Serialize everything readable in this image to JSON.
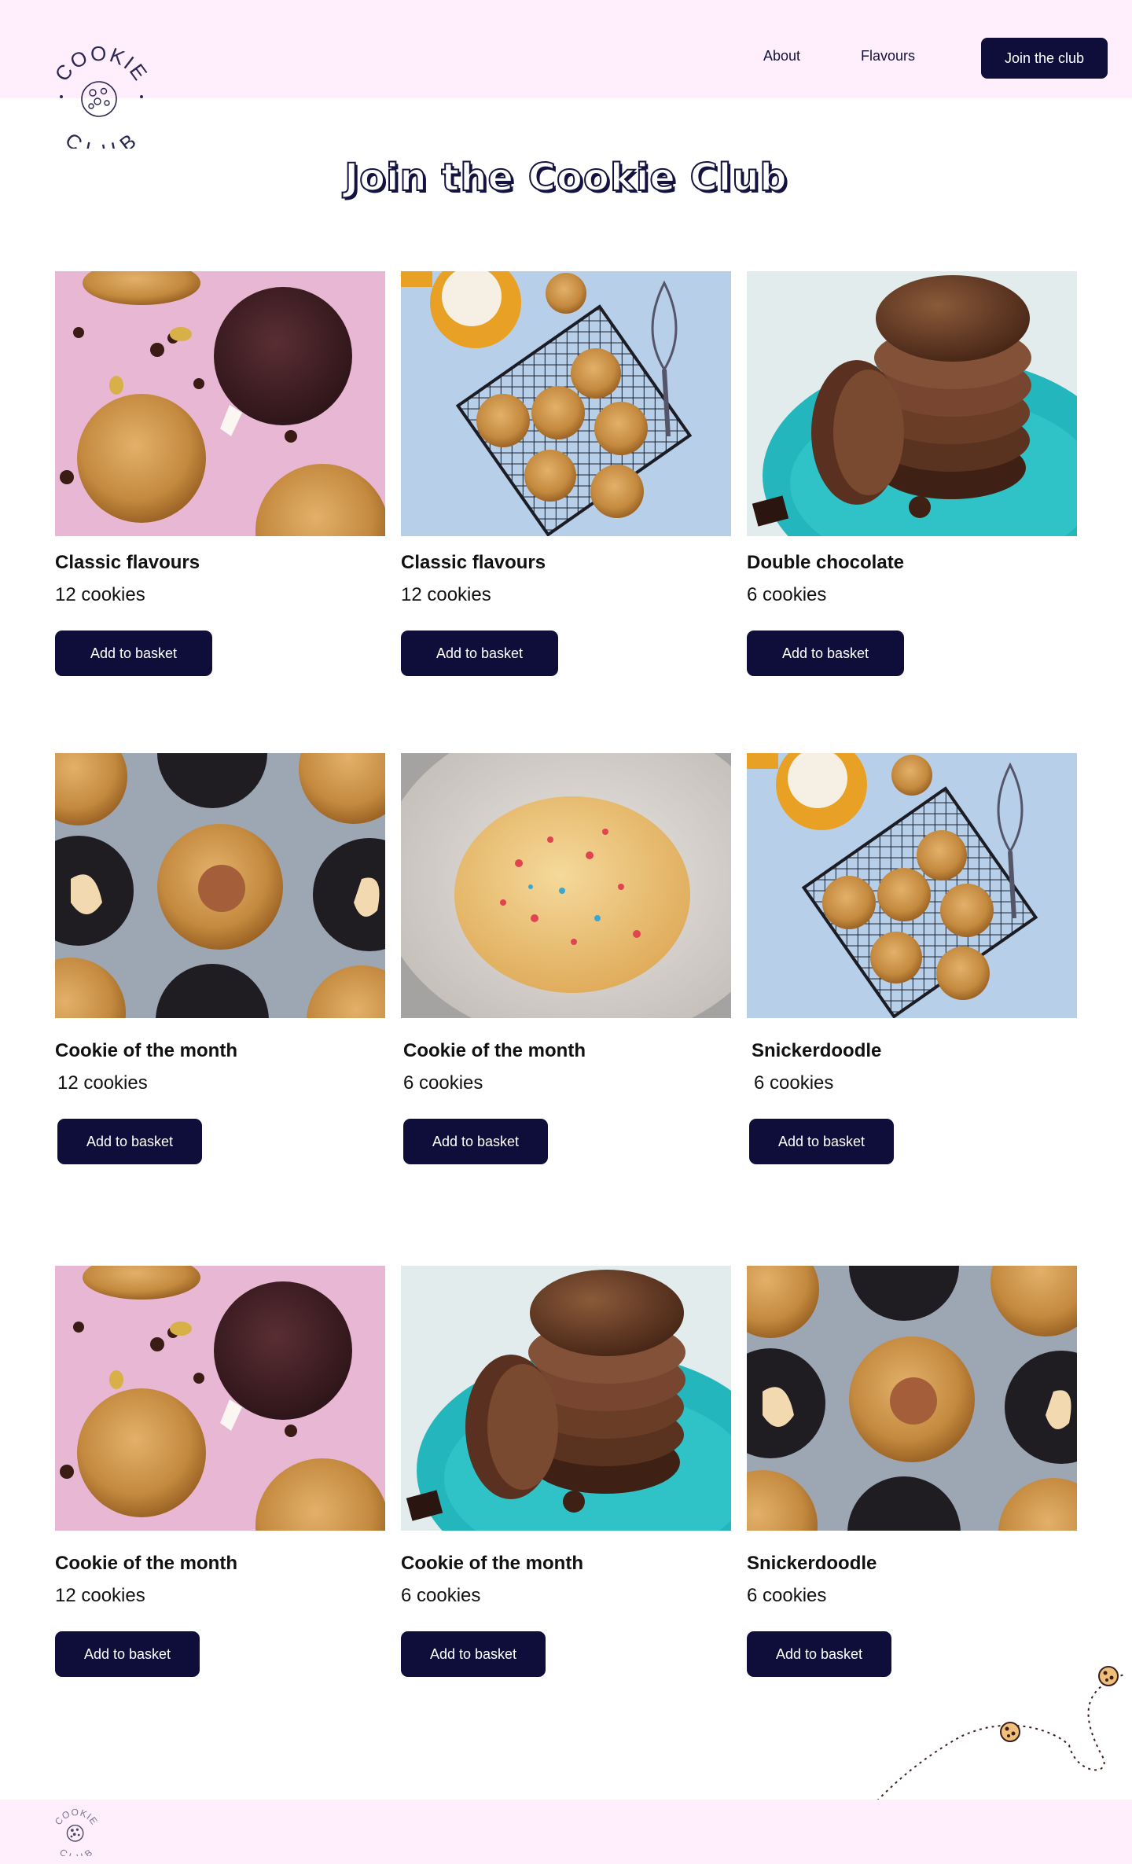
{
  "brand": {
    "logo_text_top": "COOKIE",
    "logo_text_bottom": "CLUB"
  },
  "nav": {
    "about": "About",
    "flavours": "Flavours",
    "join": "Join the club"
  },
  "page": {
    "title": "Join the Cookie Club"
  },
  "colors": {
    "header_bg": "#ffeefc",
    "button_bg": "#0f0e3a",
    "button_text": "#ffffff"
  },
  "products": [
    {
      "title": "Classic flavours",
      "count": "12 cookies",
      "button": "Add to basket",
      "image": "cookies-on-pink-photo"
    },
    {
      "title": "Classic flavours",
      "count": "12 cookies",
      "button": "Add to basket",
      "image": "cookies-on-rack-photo"
    },
    {
      "title": "Double chocolate",
      "count": "6 cookies",
      "button": "Add to basket",
      "image": "chocolate-stack-photo"
    },
    {
      "title": "Cookie of the month",
      "count": "12 cookies",
      "button": "Add to basket",
      "image": "stuffed-cookies-photo"
    },
    {
      "title": "Cookie of the month",
      "count": "6 cookies",
      "button": "Add to basket",
      "image": "sprinkle-cookie-photo"
    },
    {
      "title": "Snickerdoodle",
      "count": "6 cookies",
      "button": "Add to basket",
      "image": "cookies-on-rack-photo"
    },
    {
      "title": "Cookie of the month",
      "count": "12 cookies",
      "button": "Add to basket",
      "image": "cookies-on-pink-photo"
    },
    {
      "title": "Cookie of the month",
      "count": "6 cookies",
      "button": "Add to basket",
      "image": "chocolate-stack-photo"
    },
    {
      "title": "Snickerdoodle",
      "count": "6 cookies",
      "button": "Add to basket",
      "image": "stuffed-cookies-photo"
    }
  ]
}
